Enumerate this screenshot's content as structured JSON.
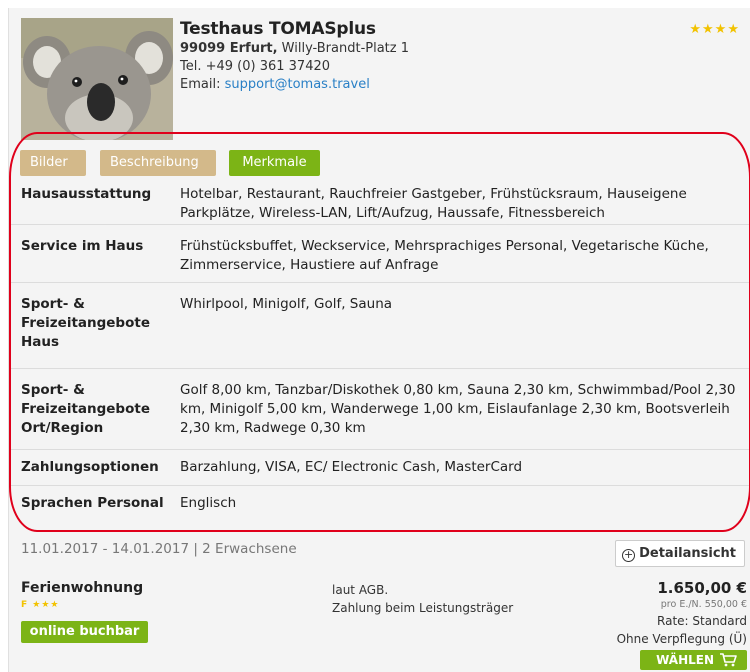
{
  "hotel": {
    "name": "Testhaus TOMASplus",
    "city": "99099 Erfurt,",
    "street": " Willy-Brandt-Platz 1",
    "phone": "Tel. +49 (0) 361 37420",
    "email_label": "Email: ",
    "email": "support@tomas.travel",
    "stars": "★★★★"
  },
  "tabs": [
    {
      "label": "Bilder"
    },
    {
      "label": "Beschreibung"
    },
    {
      "label": "Merkmale"
    }
  ],
  "features": [
    {
      "label": "Hausausstattung",
      "value": "Hotelbar, Restaurant, Rauchfreier Gastgeber, Frühstücksraum, Hauseigene Parkplätze, Wireless-LAN, Lift/Aufzug, Haussafe, Fitnessbereich"
    },
    {
      "label": "Service im Haus",
      "value": "Frühstücksbuffet, Weckservice, Mehrsprachiges Personal, Vegetarische Küche, Zimmerservice, Haustiere auf Anfrage"
    },
    {
      "label": "Sport- & Freizeitangebote Haus",
      "value": "Whirlpool, Minigolf, Golf, Sauna"
    },
    {
      "label": "Sport- & Freizeitangebote Ort/Region",
      "value": "Golf 8,00 km, Tanzbar/Diskothek 0,80 km, Sauna 2,30 km, Schwimmbad/Pool 2,30 km, Minigolf 5,00 km, Wanderwege 1,00 km, Eislaufanlage 2,30 km, Bootsverleih 2,30 km, Radwege 0,30 km"
    },
    {
      "label": "Zahlungsoptionen",
      "value": "Barzahlung, VISA, EC/ Electronic Cash, MasterCard"
    },
    {
      "label": "Sprachen Personal",
      "value": "Englisch"
    }
  ],
  "booking": {
    "dates": "11.01.2017 - 14.01.2017 | 2 Erwachsene",
    "detail_button": "Detailansicht",
    "room_title": "Ferienwohnung",
    "room_stars": "F ★★★",
    "online_button": "online buchbar",
    "terms_line1": "laut AGB.",
    "terms_line2": "Zahlung beim Leistungsträger",
    "price": "1.650,00 €",
    "per_night": "pro E./N. 550,00 €",
    "rate": "Rate: Standard",
    "meal": "Ohne Verpflegung (Ü)",
    "select_button": "WÄHLEN"
  },
  "colors": {
    "accent_green": "#7cb416",
    "tab_tan": "#d3b98a",
    "link_blue": "#2a80c6",
    "star_yellow": "#f2c200",
    "highlight_red": "#e0001b"
  }
}
